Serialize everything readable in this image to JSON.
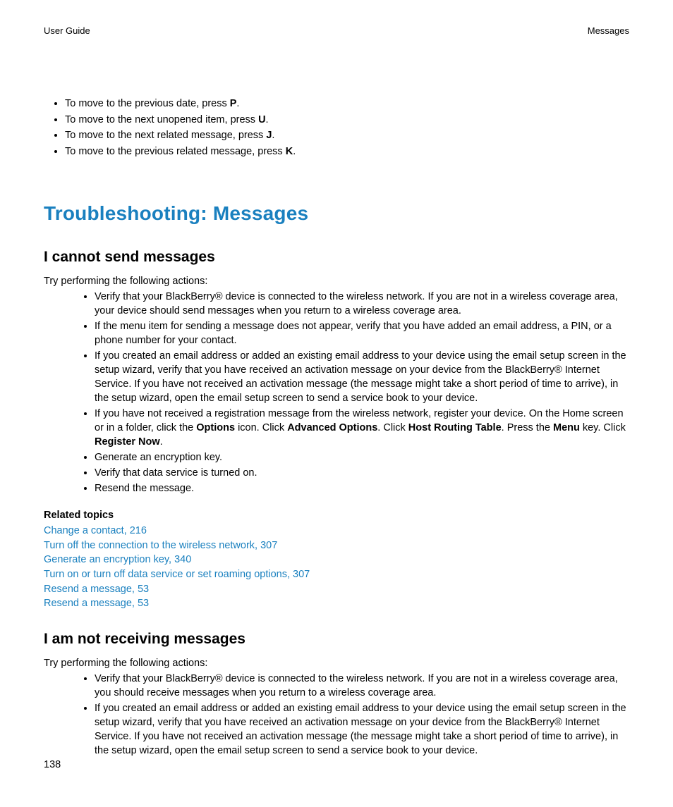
{
  "header": {
    "left": "User Guide",
    "right": "Messages"
  },
  "topList": [
    {
      "pre": "To move to the previous date, press ",
      "key": "P",
      "post": "."
    },
    {
      "pre": "To move to the next unopened item, press ",
      "key": "U",
      "post": "."
    },
    {
      "pre": "To move to the next related message, press ",
      "key": "J",
      "post": "."
    },
    {
      "pre": "To move to the previous related message, press ",
      "key": "K",
      "post": "."
    }
  ],
  "mainHeading": "Troubleshooting: Messages",
  "section1": {
    "title": "I cannot send messages",
    "intro": "Try performing the following actions:",
    "bullets": [
      [
        {
          "t": "Verify that your BlackBerry® device is connected to the wireless network. If you are not in a wireless coverage area, your device should send messages when you return to a wireless coverage area."
        }
      ],
      [
        {
          "t": "If the menu item for sending a message does not appear, verify that you have added an email address, a PIN, or a phone number for your contact."
        }
      ],
      [
        {
          "t": "If you created an email address or added an existing email address to your device using the email setup screen in the setup wizard, verify that you have received an activation message on your device from the BlackBerry® Internet Service. If you have not received an activation message (the message might take a short period of time to arrive), in the setup wizard, open the email setup screen to send a service book to your device."
        }
      ],
      [
        {
          "t": "If you have not received a registration message from the wireless network, register your device. On the Home screen or in a folder, click the "
        },
        {
          "t": "Options",
          "b": true
        },
        {
          "t": " icon. Click "
        },
        {
          "t": "Advanced Options",
          "b": true
        },
        {
          "t": ". Click "
        },
        {
          "t": "Host Routing Table",
          "b": true
        },
        {
          "t": ". Press the "
        },
        {
          "t": "Menu",
          "b": true
        },
        {
          "t": " key. Click "
        },
        {
          "t": "Register Now",
          "b": true
        },
        {
          "t": "."
        }
      ],
      [
        {
          "t": "Generate an encryption key."
        }
      ],
      [
        {
          "t": "Verify that data service is turned on."
        }
      ],
      [
        {
          "t": "Resend the message."
        }
      ]
    ],
    "relatedHeading": "Related topics",
    "relatedLinks": [
      "Change a contact, 216",
      "Turn off the connection to the wireless network, 307",
      "Generate an encryption key, 340",
      "Turn on or turn off data service or set roaming options, 307",
      "Resend a message, 53",
      "Resend a message, 53"
    ]
  },
  "section2": {
    "title": "I am not receiving messages",
    "intro": "Try performing the following actions:",
    "bullets": [
      [
        {
          "t": "Verify that your BlackBerry® device is connected to the wireless network. If you are not in a wireless coverage area, you should receive messages when you return to a wireless coverage area."
        }
      ],
      [
        {
          "t": "If you created an email address or added an existing email address to your device using the email setup screen in the setup wizard, verify that you have received an activation message on your device from the BlackBerry® Internet Service. If you have not received an activation message (the message might take a short period of time to arrive), in the setup wizard, open the email setup screen to send a service book to your device."
        }
      ]
    ]
  },
  "pageNumber": "138"
}
